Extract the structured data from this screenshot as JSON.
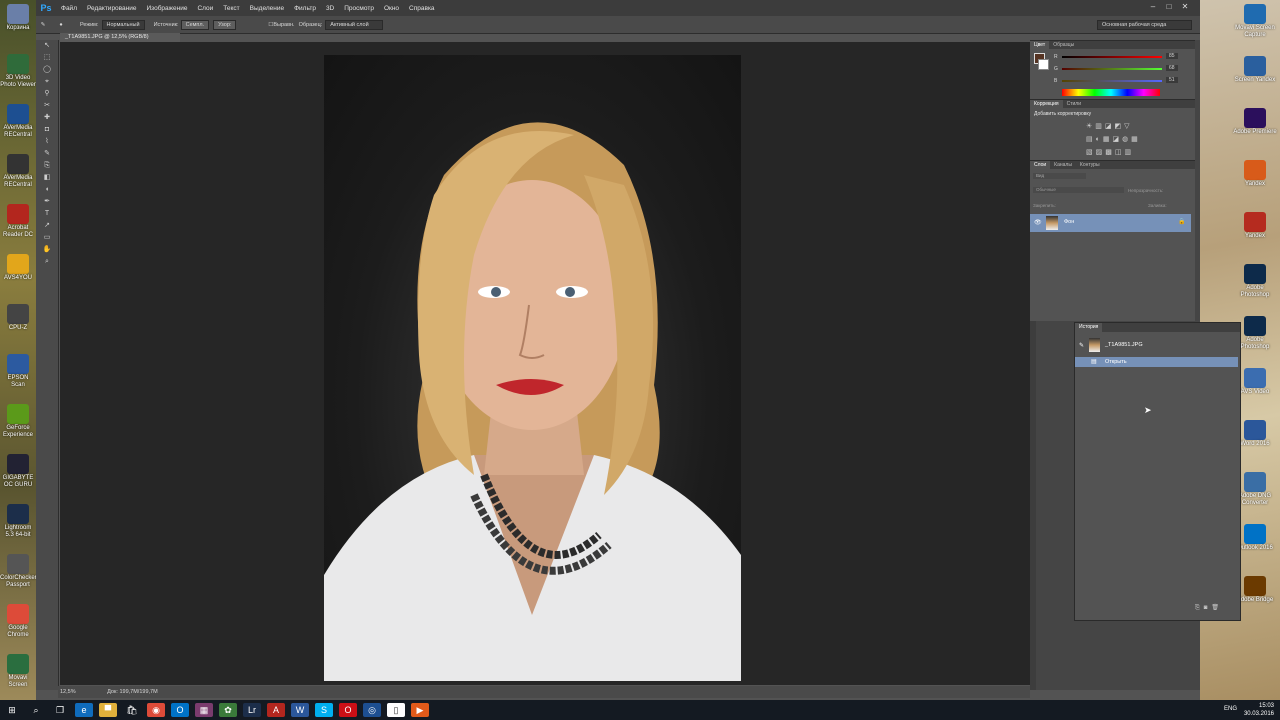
{
  "desktop_left": [
    {
      "label": "Корзина",
      "color": "#6a7fa8"
    },
    {
      "label": "3D Video Photo Viewer",
      "color": "#2f6b3a"
    },
    {
      "label": "AVerMedia RECentral",
      "color": "#1d4f91"
    },
    {
      "label": "AVerMedia RECentral",
      "color": "#333"
    },
    {
      "label": "Acrobat Reader DC",
      "color": "#b3261e"
    },
    {
      "label": "AVS4YOU",
      "color": "#e2a61b"
    },
    {
      "label": "CPU-Z",
      "color": "#444"
    },
    {
      "label": "EPSON Scan",
      "color": "#2c5aa0"
    },
    {
      "label": "GeForce Experience",
      "color": "#5b9a1a"
    },
    {
      "label": "GIGABYTE OC GURU",
      "color": "#223"
    },
    {
      "label": "Lightroom 5.3 64-bit",
      "color": "#1c2e4a"
    },
    {
      "label": "ColorChecker Passport",
      "color": "#555"
    },
    {
      "label": "Google Chrome",
      "color": "#dd4b39"
    },
    {
      "label": "Movavi Screen",
      "color": "#2a6e3f"
    }
  ],
  "desktop_right": [
    {
      "label": "Movavi Screen Capture",
      "color": "#1f6bb0"
    },
    {
      "label": "Screen Yandex",
      "color": "#2a5f9e"
    },
    {
      "label": "Adobe Premiere",
      "color": "#2b0f5c"
    },
    {
      "label": "Yandex",
      "color": "#d85b1a"
    },
    {
      "label": "Yandex",
      "color": "#b52b1f"
    },
    {
      "label": "Adobe Photoshop",
      "color": "#0d2a4a"
    },
    {
      "label": "Adobe Photoshop",
      "color": "#0d2a4a"
    },
    {
      "label": "AVS Video",
      "color": "#3b6db0"
    },
    {
      "label": "Word 2016",
      "color": "#2b579a"
    },
    {
      "label": "Adobe DNG Converter",
      "color": "#3a6ea5"
    },
    {
      "label": "Outlook 2016",
      "color": "#0072c6"
    },
    {
      "label": "Adobe Bridge",
      "color": "#6b3a00"
    }
  ],
  "photoshop": {
    "logo": "Ps",
    "menu": [
      "Файл",
      "Редактирование",
      "Изображение",
      "Слои",
      "Текст",
      "Выделение",
      "Фильтр",
      "3D",
      "Просмотр",
      "Окно",
      "Справка"
    ],
    "options": {
      "mode_label": "Режим:",
      "mode_value": "Нормальный",
      "source_label": "Источник:",
      "source_btn1": "Семпл.",
      "source_btn2": "Узор:",
      "align_label": "Выравн.",
      "sample_label": "Образец:",
      "sample_value": "Активный слой",
      "workspace": "Основная рабочая среда"
    },
    "doc_tab": "_T1A9851.JPG @ 12,5% (RGB/8)",
    "status_zoom": "12,5%",
    "status_doc": "Док: 199,7M/199,7M",
    "color_panel": {
      "tabs": [
        "Цвет",
        "Образцы"
      ],
      "r_label": "R",
      "r_value": "85",
      "g_label": "G",
      "g_value": "68",
      "b_label": "B",
      "b_value": "51"
    },
    "adjust_panel": {
      "tabs": [
        "Коррекция",
        "Стили"
      ],
      "title": "Добавить корректировку"
    },
    "layers_panel": {
      "tabs": [
        "Слои",
        "Каналы",
        "Контуры"
      ],
      "kind": "Вид",
      "blend": "Обычные",
      "opacity_label": "Непрозрачность:",
      "lock_label": "Закрепить:",
      "fill_label": "Заливка:",
      "layer_name": "Фон"
    },
    "history_panel": {
      "title": "История",
      "snapshot": "_T1A9851.JPG",
      "step": "Открыть"
    }
  },
  "taskbar": {
    "time": "15:03",
    "date": "30.03.2016",
    "lang": "ENG"
  }
}
